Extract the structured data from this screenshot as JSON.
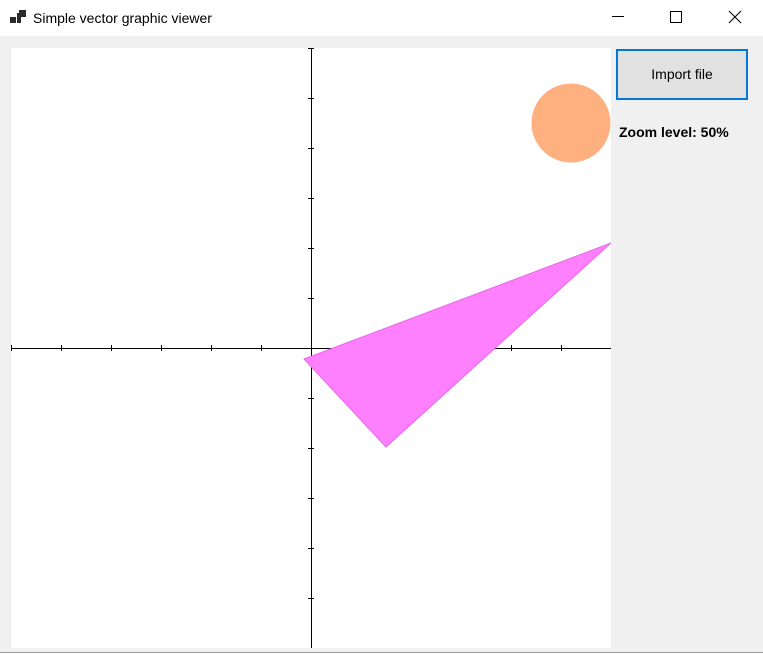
{
  "window": {
    "title": "Simple vector graphic viewer",
    "controls": {
      "minimize": "minimize-icon",
      "maximize": "maximize-icon",
      "close": "close-icon"
    }
  },
  "toolbar": {
    "import_label": "Import file"
  },
  "status": {
    "zoom_text": "Zoom level: 50%"
  },
  "canvas": {
    "background": "#ffffff",
    "axis_color": "#000000",
    "shapes": [
      {
        "type": "circle",
        "fill": "#ffb07f"
      },
      {
        "type": "triangle",
        "fill": "#ff80ff",
        "stroke": "#e868e8"
      }
    ]
  }
}
